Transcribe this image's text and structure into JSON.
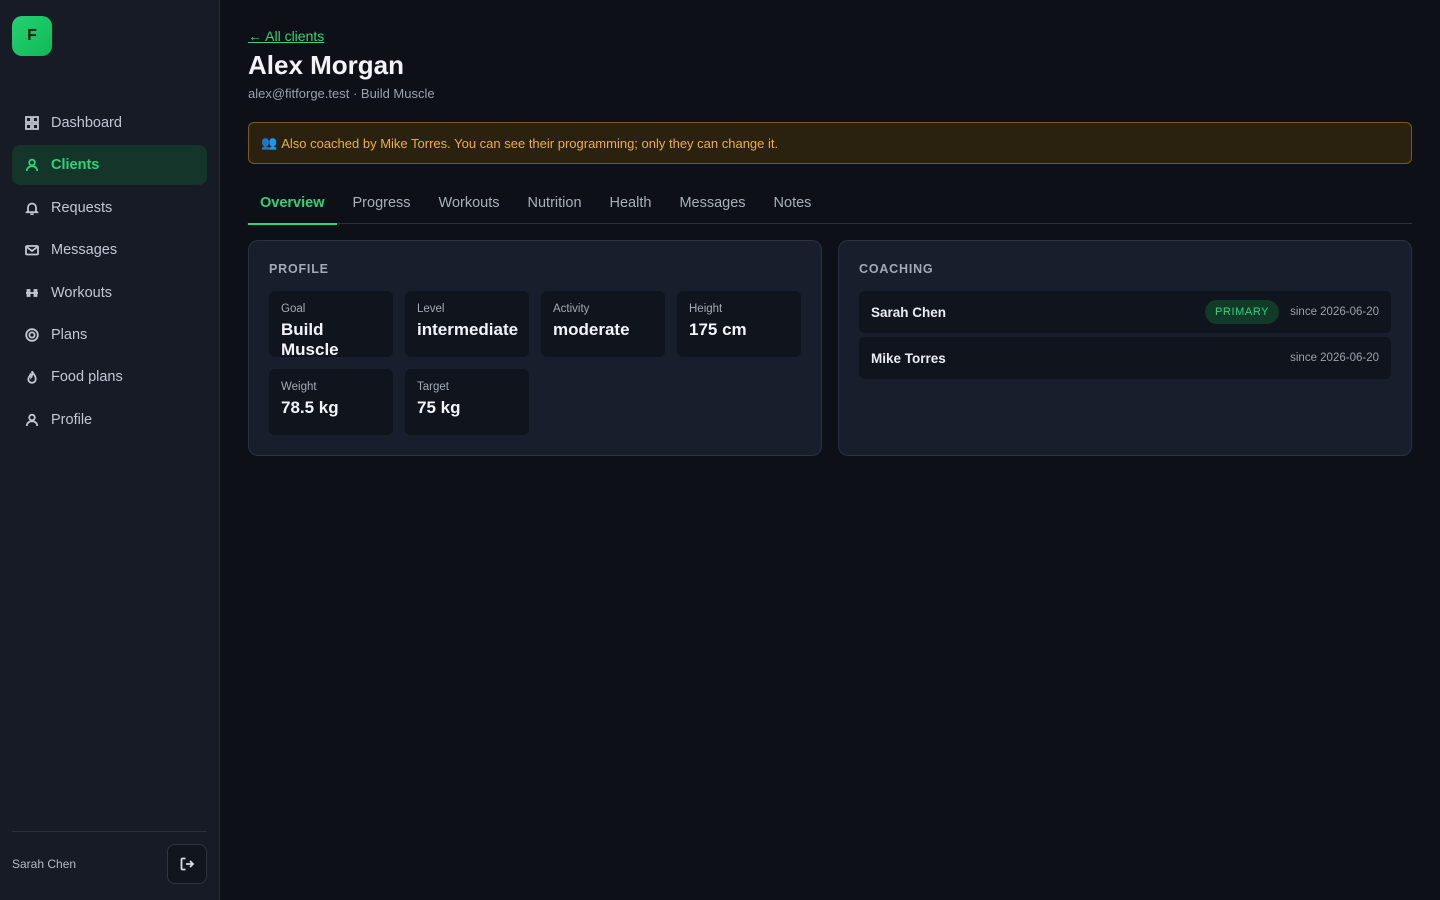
{
  "brand": {
    "logo_letter": "F",
    "accent": "#2ed47a"
  },
  "sidebar": {
    "items": [
      {
        "label": "Dashboard",
        "icon": "grid-icon"
      },
      {
        "label": "Clients",
        "icon": "user-icon",
        "active": true
      },
      {
        "label": "Requests",
        "icon": "bell-icon"
      },
      {
        "label": "Messages",
        "icon": "mail-icon"
      },
      {
        "label": "Workouts",
        "icon": "dumbbell-icon"
      },
      {
        "label": "Plans",
        "icon": "target-icon"
      },
      {
        "label": "Food plans",
        "icon": "flame-icon"
      },
      {
        "label": "Profile",
        "icon": "user-icon"
      }
    ],
    "user_name": "Sarah Chen"
  },
  "header": {
    "back_link": "← All clients",
    "title": "Alex Morgan",
    "subtitle": "alex@fitforge.test · Build Muscle"
  },
  "banner": {
    "icon": "👥",
    "text": "Also coached by Mike Torres. You can see their programming; only they can change it."
  },
  "tabs": [
    {
      "label": "Overview",
      "active": true
    },
    {
      "label": "Progress"
    },
    {
      "label": "Workouts"
    },
    {
      "label": "Nutrition"
    },
    {
      "label": "Health"
    },
    {
      "label": "Messages"
    },
    {
      "label": "Notes"
    }
  ],
  "profile": {
    "title": "PROFILE",
    "stats": [
      {
        "label": "Goal",
        "value": "Build Muscle"
      },
      {
        "label": "Level",
        "value": "intermediate"
      },
      {
        "label": "Activity",
        "value": "moderate"
      },
      {
        "label": "Height",
        "value": "175 cm"
      },
      {
        "label": "Weight",
        "value": "78.5 kg"
      },
      {
        "label": "Target",
        "value": "75 kg"
      }
    ]
  },
  "coaching": {
    "title": "COACHING",
    "coaches": [
      {
        "name": "Sarah Chen",
        "badge": "PRIMARY",
        "since": "since 2026-06-20"
      },
      {
        "name": "Mike Torres",
        "badge": "",
        "since": "since 2026-06-20"
      }
    ]
  }
}
